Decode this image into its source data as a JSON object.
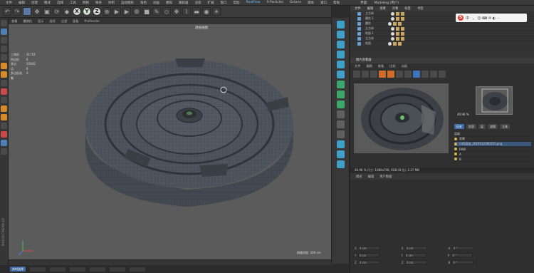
{
  "menubar": {
    "items": [
      "文件",
      "编辑",
      "创建",
      "模式",
      "选择",
      "工具",
      "网格",
      "样条",
      "体积",
      "运动图形",
      "角色",
      "动画",
      "模拟",
      "跟踪器",
      "渲染",
      "扩展",
      "窗口",
      "帮助",
      "RealFlow",
      "X-Particles",
      "Octane",
      "脚本",
      "窗口",
      "帮助"
    ],
    "highlight_index": 18,
    "layout_label": "界面:",
    "layout_value": "Modeling (用户)"
  },
  "toolbar": {
    "x": "X",
    "y": "Y",
    "z": "Z"
  },
  "viewport": {
    "menu": [
      "查看",
      "摄像机",
      "显示",
      "选项",
      "过滤",
      "面板",
      "ProRender"
    ],
    "label": "透视视图",
    "stats": [
      {
        "k": "三角形",
        "v": "31752"
      },
      {
        "k": "四边形",
        "v": "6"
      },
      {
        "k": "多边",
        "v": "15945"
      },
      {
        "k": "点",
        "v": "6"
      },
      {
        "k": "多边形选集",
        "v": "0"
      }
    ],
    "grid_label": "网格间距: 100 cm"
  },
  "objects": {
    "tabs": [
      "文件",
      "编辑",
      "查看",
      "对象",
      "标签",
      "书签"
    ],
    "rows": [
      "立方体",
      "圆柱.1",
      "圆柱",
      "立方体",
      "地面.1",
      "立方体",
      "地面"
    ]
  },
  "sysbar": {
    "logo": "S",
    "text": "中 ‧ 。 ☺ ⌨ ✉ ◐ ⋯"
  },
  "picture_viewer": {
    "title": "图片查看器",
    "menu": [
      "文件",
      "编辑",
      "查看",
      "比较",
      "动画"
    ],
    "zoom": "40.96 %",
    "tag_tabs": [
      "历史",
      "信息",
      "层",
      "滤镜",
      "立体"
    ],
    "layers_header": "层级",
    "layers": [
      "背景",
      "C4D渲染_2019112280155.png",
      "RAW",
      "A",
      "B"
    ],
    "status": "40.96 %    尺寸: 1080x706, RGB (8 位), 2.27 MB"
  },
  "attributes": {
    "menu": [
      "模式",
      "编辑",
      "用户数据"
    ]
  },
  "coords": [
    {
      "a": "X",
      "v": "0 cm",
      "b": "X",
      "bv": "0 cm",
      "c": "H",
      "cv": "0 °"
    },
    {
      "a": "Y",
      "v": "0 cm",
      "b": "Y",
      "bv": "0 cm",
      "c": "P",
      "cv": "0 °"
    },
    {
      "a": "Z",
      "v": "0 cm",
      "b": "Z",
      "bv": "0 cm",
      "c": "B",
      "cv": "0 °"
    }
  ],
  "statusbar": {
    "button": "实时选择"
  },
  "brand": "MAXON CINEMA 4D",
  "colors": {
    "accent": "#6fc1ff",
    "mesh": "#4a5058",
    "viewport_bg": "#5b5b5b"
  }
}
